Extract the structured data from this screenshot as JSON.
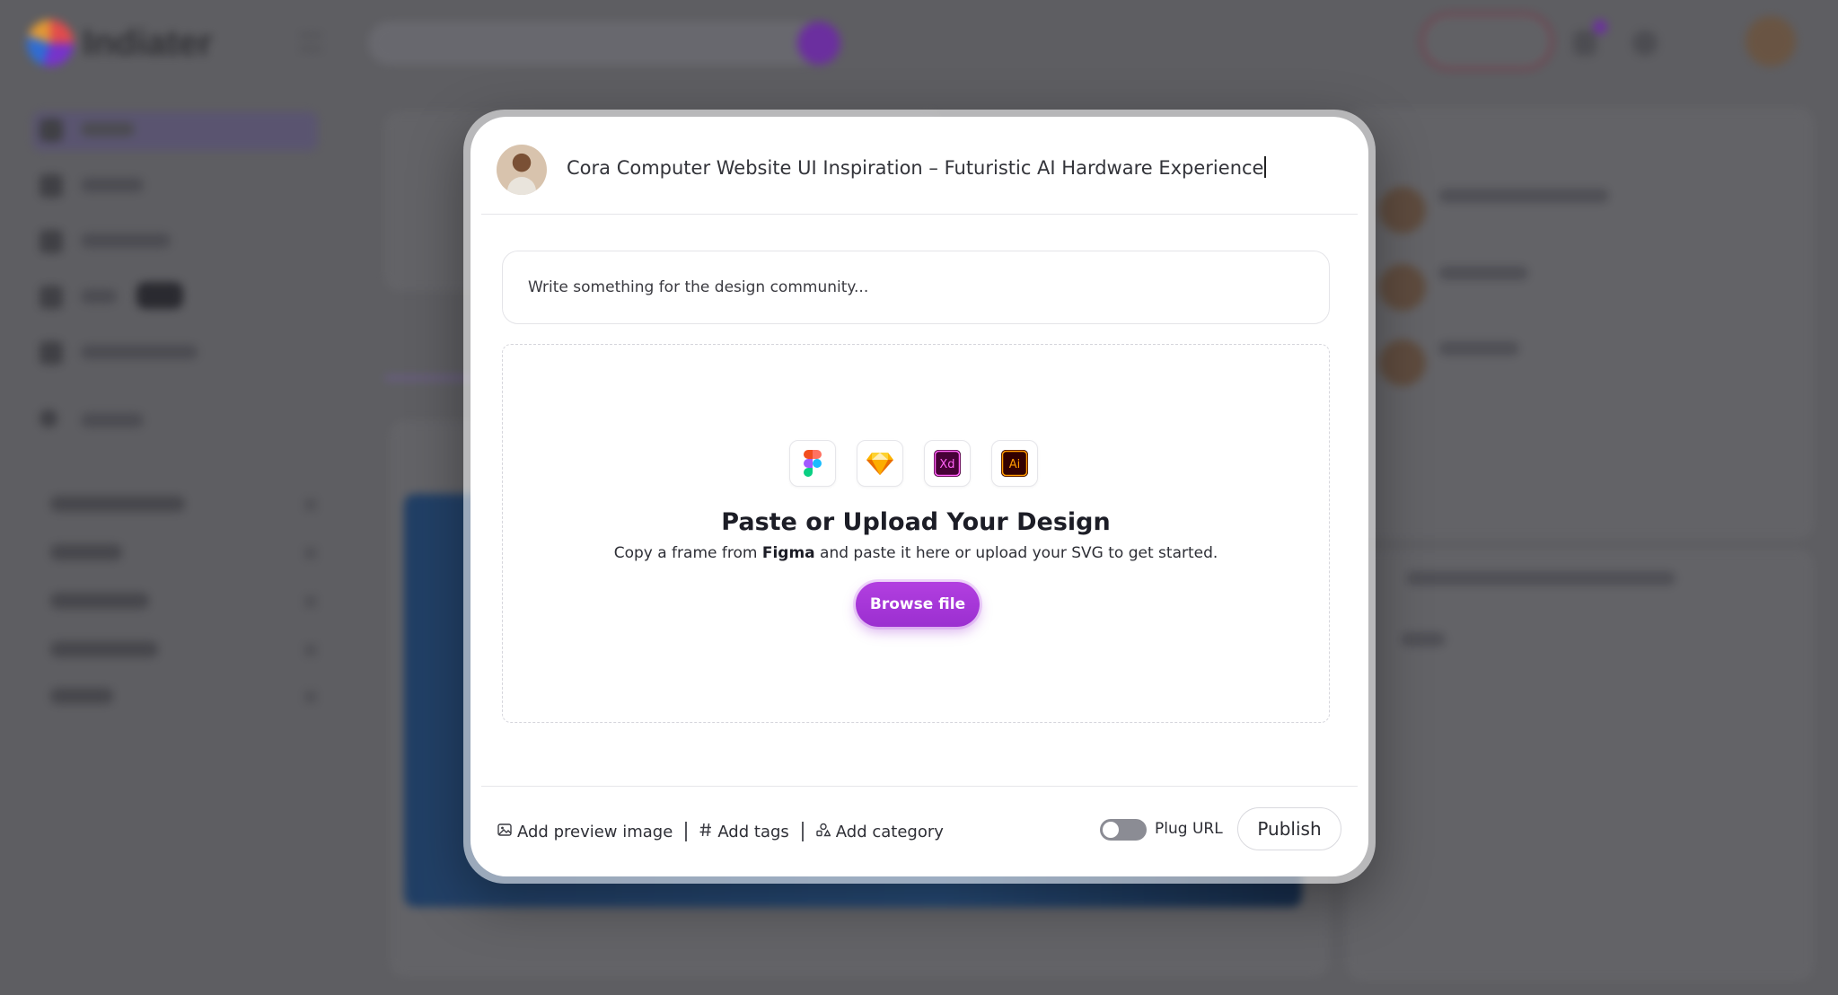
{
  "background": {
    "logo_text": "Indiater"
  },
  "modal": {
    "title": "Cora Computer Website UI Inspiration – Futuristic AI Hardware Experience",
    "description_placeholder": "Write something for the design community...",
    "dropzone": {
      "apps": [
        {
          "name": "figma-icon",
          "label": ""
        },
        {
          "name": "sketch-icon",
          "label": ""
        },
        {
          "name": "xd-icon",
          "label": "Xd"
        },
        {
          "name": "illustrator-icon",
          "label": "Ai"
        }
      ],
      "title": "Paste or Upload Your Design",
      "subtitle_before": "Copy a frame from ",
      "subtitle_bold": "Figma",
      "subtitle_after": " and paste it here or upload your SVG to get started.",
      "browse_label": "Browse file"
    },
    "footer": {
      "add_preview_label": "Add preview image",
      "add_tags_label": "Add tags",
      "add_category_label": "Add category",
      "plug_url_label": "Plug URL",
      "plug_url_enabled": false,
      "publish_label": "Publish"
    }
  },
  "colors": {
    "accent": "#9b2fd0",
    "overlay": "#5e5e62",
    "modal_bg": "#ffffff"
  }
}
